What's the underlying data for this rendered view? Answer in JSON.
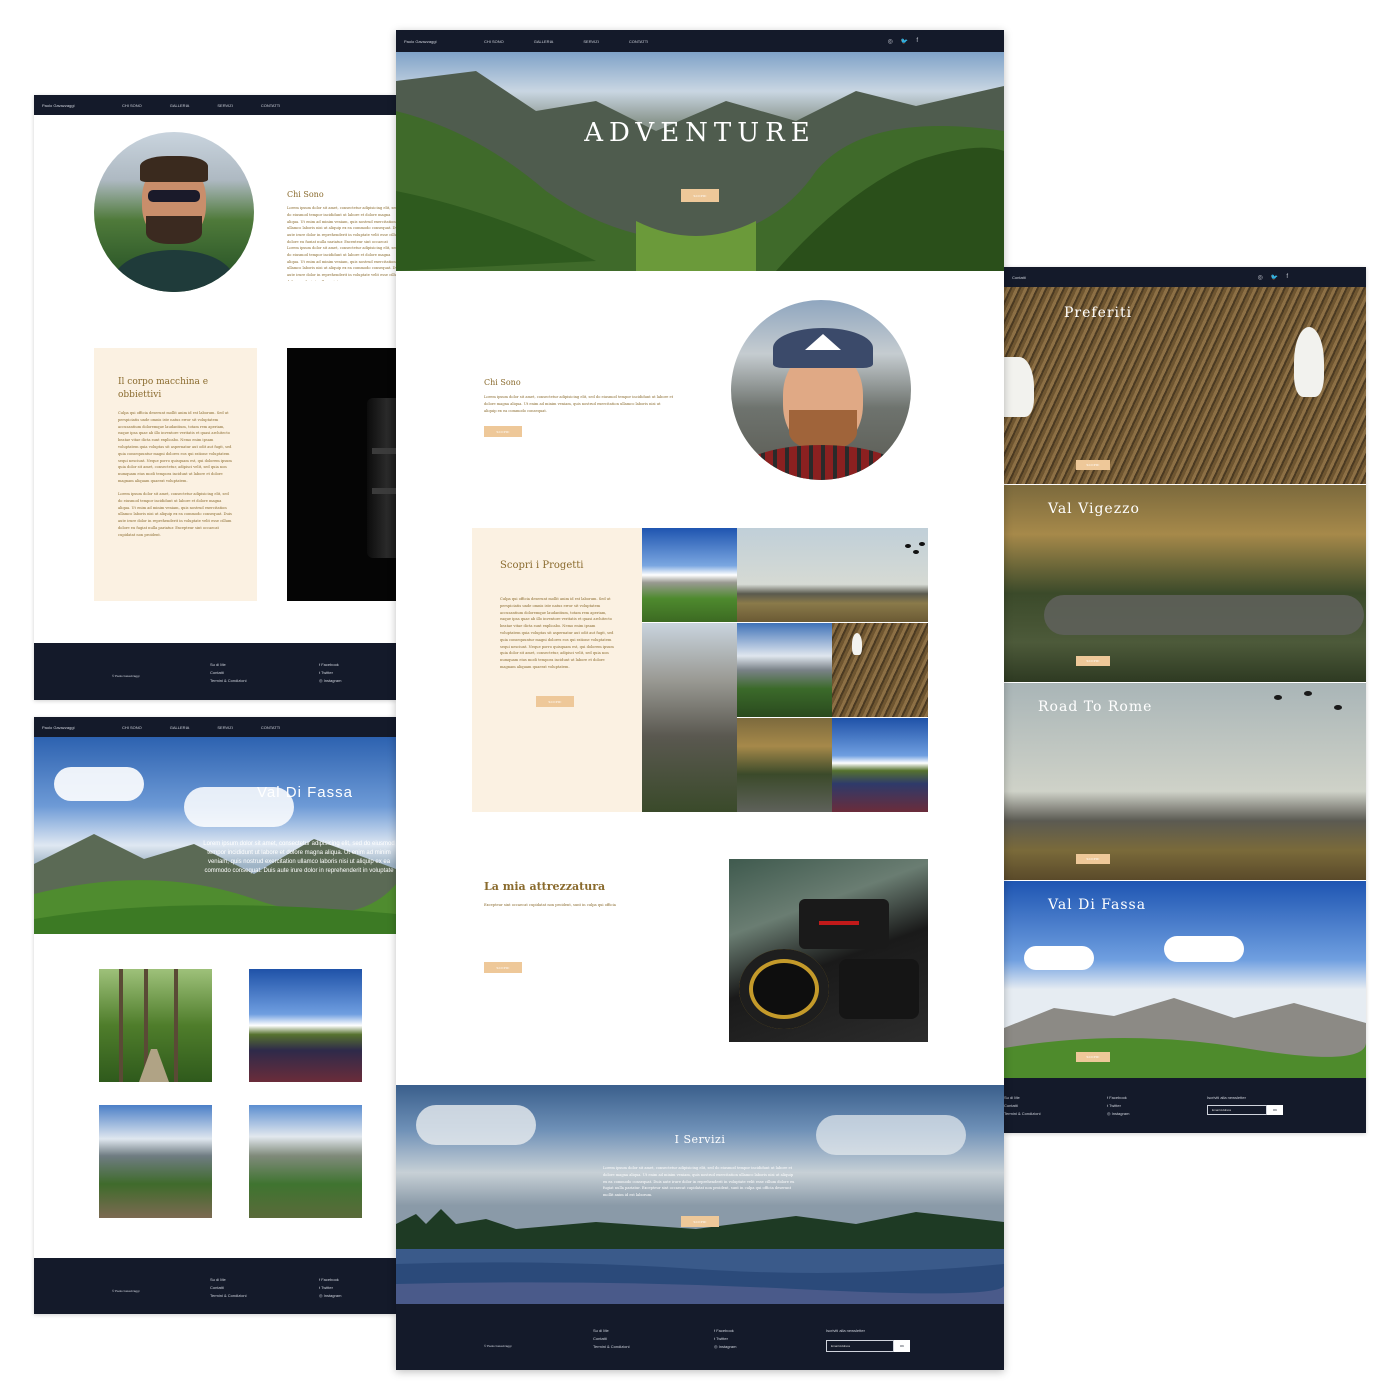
{
  "brand": "Paolo Gavazzaggi",
  "nav_links": [
    "CHI SONO",
    "GALLERIA",
    "SERVIZI",
    "CONTATTI"
  ],
  "social_glyphs": [
    "◎",
    "🐦",
    "f"
  ],
  "left_top": {
    "heading": "Chi Sono",
    "para1": "Lorem ipsum dolor sit amet, consectetur adipisicing elit, sed do eiusmod tempor incididunt ut labore et dolore magna aliqua. Ut enim ad minim veniam, quis nostrud exercitation ullamco laboris nisi ut aliquip ex ea commodo consequat. Duis aute irure dolor in reprehenderit in voluptate velit esse cillum dolore eu fugiat nulla pariatur. Excepteur sint occaecat cupidatat non proident, sunt in culpa qui officia deserunt mollit.",
    "para2": "Lorem ipsum dolor sit amet, consectetur adipisicing elit, sed do eiusmod tempor incididunt ut labore et dolore magna aliqua. Ut enim ad minim veniam, quis nostrud exercitation ullamco laboris nisi ut aliquip ex ea commodo consequat. Duis aute irure dolor in reprehenderit in voluptate velit esse cillum dolore eu fugiat nulla pariatur.",
    "card_title": "Il corpo macchina e obbiettivi",
    "card_p1": "Culpa qui officia deserunt mollit anim id est laborum. Sed ut perspiciatis unde omnis iste natus error sit voluptatem accusantium doloremque laudantium, totam rem aperiam, eaque ipsa quae ab illo inventore veritatis et quasi architecto beatae vitae dicta sunt explicabo. Nemo enim ipsam voluptatem quia voluptas sit aspernatur aut odit aut fugit, sed quia consequuntur magni dolores eos qui ratione voluptatem sequi nesciunt. Neque porro quisquam est, qui dolorem ipsum quia dolor sit amet, consectetur, adipisci velit, sed quia non numquam eius modi tempora incidunt ut labore et dolore magnam aliquam quaerat voluptatem.",
    "card_p2": "Lorem ipsum dolor sit amet, consectetur adipisicing elit, sed do eiusmod tempor incididunt ut labore et dolore magna aliqua. Ut enim ad minim veniam, quis nostrud exercitation ullamco laboris nisi ut aliquip ex ea commodo consequat. Duis aute irure dolor in reprehenderit in voluptate velit esse cillum dolore eu fugiat nulla pariatur. Excepteur sint occaecat cupidatat non proident."
  },
  "footer": {
    "copyright": "© Paolo Gavazzaggi",
    "links": [
      "Su di Me",
      "Contatti",
      "Termini & Condizioni"
    ],
    "social": [
      "Facebook",
      "Twitter",
      "Instagram"
    ],
    "newsletter": "Iscriviti alla newsletter",
    "email_placeholder": "Email Address",
    "ok": "OK"
  },
  "left_bottom": {
    "hero_title": "Val Di Fassa",
    "hero_text": "Lorem ipsum dolor sit amet, consectetur adipisicing elit, sed do eiusmod tempor incididunt ut labore et dolore magna aliqua. Ut enim ad minim veniam, quis nostrud exercitation ullamco laboris nisi ut aliquip ex ea commodo consequat. Duis aute irure dolor in reprehenderit in voluptate velit esse cillum dolore."
  },
  "center": {
    "hero_title": "ADVENTURE",
    "hero_btn": "SCOPRI",
    "about_heading": "Chi Sono",
    "about_text": "Lorem ipsum dolor sit amet, consectetur adipisicing elit, sed do eiusmod tempor incididunt ut labore et dolore magna aliqua. Ut enim ad minim veniam, quis nostrud exercitation ullamco laboris nisi ut aliquip ex ea commodo consequat.",
    "about_btn": "SCOPRI",
    "projects_title": "Scopri i Progetti",
    "projects_text": "Culpa qui officia deserunt mollit anim id est laborum. Sed ut perspiciatis unde omnis iste natus error sit voluptatem accusantium doloremque laudantium, totam rem aperiam, eaque ipsa quae ab illo inventore veritatis et quasi architecto beatae vitae dicta sunt explicabo. Nemo enim ipsam voluptatem quia voluptas sit aspernatur aut odit aut fugit, sed quia consequuntur magni dolores eos qui ratione voluptatem sequi nesciunt. Neque porro quisquam est, qui dolorem ipsum quia dolor sit amet, consectetur, adipisci velit, sed quia non numquam eius modi tempora incidunt ut labore et dolore magnam aliquam quaerat voluptatem.",
    "projects_btn": "SCOPRI",
    "gear_title": "La mia attrezzatura",
    "gear_text": "Excepteur sint occaecat cupidatat non proident, sunt in culpa qui officia",
    "gear_btn": "SCOPRI",
    "services_title": "I Servizi",
    "services_text": "Lorem ipsum dolor sit amet, consectetur adipisicing elit, sed do eiusmod tempor incididunt ut labore et dolore magna aliqua. Ut enim ad minim veniam, quis nostrud exercitation ullamco laboris nisi ut aliquip ex ea commodo consequat. Duis aute irure dolor in reprehenderit in voluptate velit esse cillum dolore eu fugiat nulla pariatur. Excepteur sint occaecat cupidatat non proident, sunt in culpa qui officia deserunt mollit anim id est laborum.",
    "services_btn": "SCOPRI"
  },
  "right": {
    "brand": "Contatti",
    "cards": [
      {
        "title": "Preferiti",
        "btn": "SCOPRI"
      },
      {
        "title": "Val Vigezzo",
        "btn": "SCOPRI"
      },
      {
        "title": "Road To Rome",
        "btn": "SCOPRI"
      },
      {
        "title": "Val Di Fassa",
        "btn": "SCOPRI"
      }
    ]
  }
}
